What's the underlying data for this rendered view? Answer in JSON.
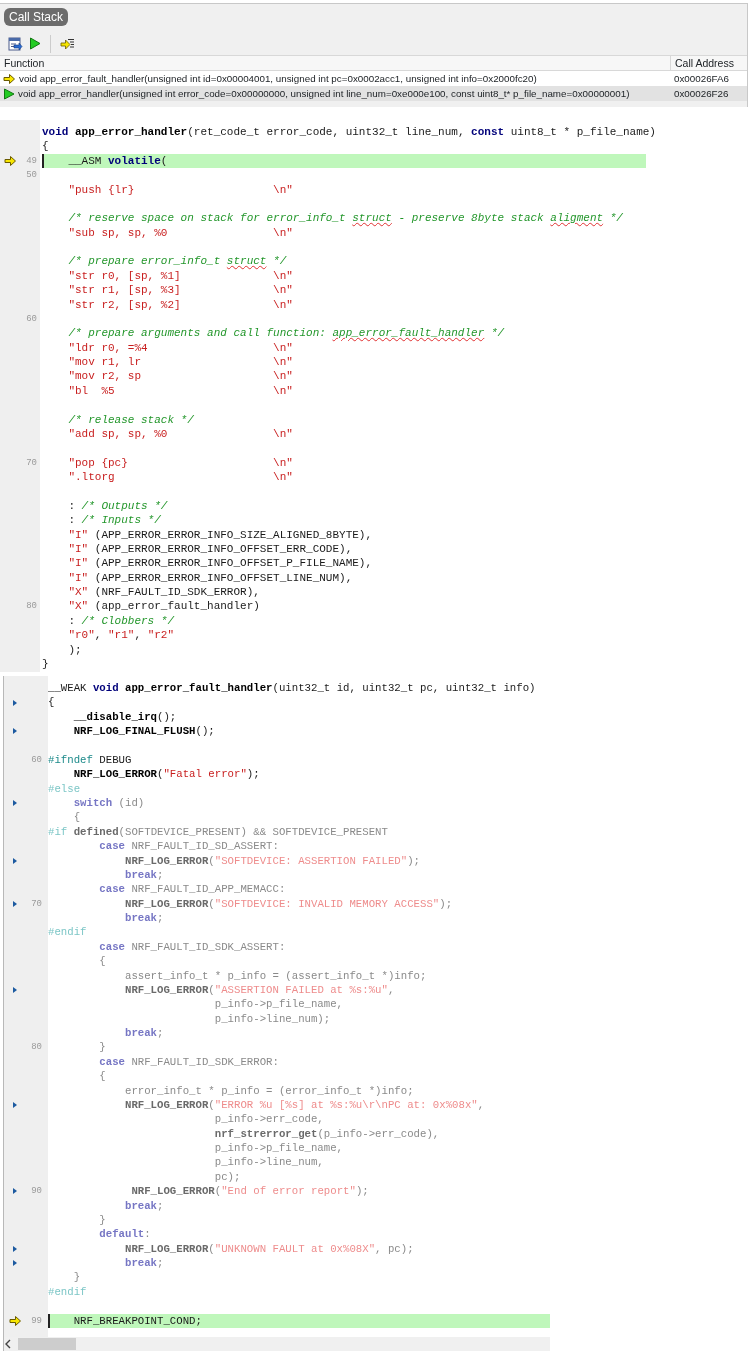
{
  "call_stack": {
    "tab": {
      "label": "Call Stack",
      "selected": true
    },
    "columns": [
      "Function",
      "Call Address"
    ],
    "rows": [
      {
        "kind": "caller",
        "selected": false,
        "function": "void app_error_fault_handler(unsigned int id=0x00004001, unsigned int pc=0x0002acc1, unsigned int info=0x2000fc20)",
        "address": "0x00026FA6"
      },
      {
        "kind": "current",
        "selected": true,
        "function": "void app_error_handler(unsigned int error_code=0x00000000, unsigned int line_num=0xe000e100, const uint8_t* p_file_name=0x00000001)",
        "address": "0x00026F26"
      }
    ]
  },
  "editors": [
    {
      "lines": [
        {
          "kind": "code",
          "tokens": [
            {
              "kind": "keyword",
              "text": "void"
            },
            {
              "kind": "func",
              "text": " app_error_handler"
            },
            {
              "kind": "plain",
              "text": "(ret_code_t error_code, uint32_t line_num, "
            },
            {
              "kind": "keyword",
              "text": "const"
            },
            {
              "kind": "plain",
              "text": " uint8_t * p_file_name)"
            }
          ]
        },
        {
          "kind": "code",
          "tokens": [
            {
              "kind": "plain",
              "text": "{"
            }
          ]
        },
        {
          "kind": "current",
          "number": "49",
          "tokens": [
            {
              "kind": "plain",
              "text": "    __ASM "
            },
            {
              "kind": "keyword",
              "text": "volatile"
            },
            {
              "kind": "plain",
              "text": "("
            }
          ]
        },
        {
          "kind": "blank",
          "number": "50"
        },
        {
          "kind": "code",
          "tokens": [
            {
              "kind": "string",
              "text": "    \"push {lr}                     \\n\""
            }
          ]
        },
        {
          "kind": "blank"
        },
        {
          "kind": "code",
          "tokens": [
            {
              "kind": "comment",
              "text": "    /* reserve space on stack for error_info_t "
            },
            {
              "kind": "spell",
              "text": "struct"
            },
            {
              "kind": "comment",
              "text": " - preserve 8byte stack "
            },
            {
              "kind": "spell",
              "text": "aligment"
            },
            {
              "kind": "comment",
              "text": " */"
            }
          ]
        },
        {
          "kind": "code",
          "tokens": [
            {
              "kind": "string",
              "text": "    \"sub sp, sp, %0                \\n\""
            }
          ]
        },
        {
          "kind": "blank"
        },
        {
          "kind": "code",
          "tokens": [
            {
              "kind": "comment",
              "text": "    /* prepare error_info_t "
            },
            {
              "kind": "spell",
              "text": "struct"
            },
            {
              "kind": "comment",
              "text": " */"
            }
          ]
        },
        {
          "kind": "code",
          "tokens": [
            {
              "kind": "string",
              "text": "    \"str r0, [sp, %1]              \\n\""
            }
          ]
        },
        {
          "kind": "code",
          "tokens": [
            {
              "kind": "string",
              "text": "    \"str r1, [sp, %3]              \\n\""
            }
          ]
        },
        {
          "kind": "code",
          "tokens": [
            {
              "kind": "string",
              "text": "    \"str r2, [sp, %2]              \\n\""
            }
          ]
        },
        {
          "kind": "blank",
          "number": "60"
        },
        {
          "kind": "code",
          "tokens": [
            {
              "kind": "comment",
              "text": "    /* prepare arguments and call function: "
            },
            {
              "kind": "spell",
              "text": "app_error_fault_handler"
            },
            {
              "kind": "comment",
              "text": " */"
            }
          ]
        },
        {
          "kind": "code",
          "tokens": [
            {
              "kind": "string",
              "text": "    \"ldr r0, =%4                   \\n\""
            }
          ]
        },
        {
          "kind": "code",
          "tokens": [
            {
              "kind": "string",
              "text": "    \"mov r1, lr                    \\n\""
            }
          ]
        },
        {
          "kind": "code",
          "tokens": [
            {
              "kind": "string",
              "text": "    \"mov r2, sp                    \\n\""
            }
          ]
        },
        {
          "kind": "code",
          "tokens": [
            {
              "kind": "string",
              "text": "    \"bl  %5                        \\n\""
            }
          ]
        },
        {
          "kind": "blank"
        },
        {
          "kind": "code",
          "tokens": [
            {
              "kind": "comment",
              "text": "    /* release stack */"
            }
          ]
        },
        {
          "kind": "code",
          "tokens": [
            {
              "kind": "string",
              "text": "    \"add sp, sp, %0                \\n\""
            }
          ]
        },
        {
          "kind": "blank"
        },
        {
          "kind": "code",
          "number": "70",
          "tokens": [
            {
              "kind": "string",
              "text": "    \"pop {pc}                      \\n\""
            }
          ]
        },
        {
          "kind": "code",
          "tokens": [
            {
              "kind": "string",
              "text": "    \".ltorg                        \\n\""
            }
          ]
        },
        {
          "kind": "blank"
        },
        {
          "kind": "code",
          "tokens": [
            {
              "kind": "plain",
              "text": "    : "
            },
            {
              "kind": "comment",
              "text": "/* Outputs */"
            }
          ]
        },
        {
          "kind": "code",
          "tokens": [
            {
              "kind": "plain",
              "text": "    : "
            },
            {
              "kind": "comment",
              "text": "/* Inputs */"
            }
          ]
        },
        {
          "kind": "code",
          "tokens": [
            {
              "kind": "string",
              "text": "    \"I\""
            },
            {
              "kind": "plain",
              "text": " (APP_ERROR_ERROR_INFO_SIZE_ALIGNED_8BYTE),"
            }
          ]
        },
        {
          "kind": "code",
          "tokens": [
            {
              "kind": "string",
              "text": "    \"I\""
            },
            {
              "kind": "plain",
              "text": " (APP_ERROR_ERROR_INFO_OFFSET_ERR_CODE),"
            }
          ]
        },
        {
          "kind": "code",
          "tokens": [
            {
              "kind": "string",
              "text": "    \"I\""
            },
            {
              "kind": "plain",
              "text": " (APP_ERROR_ERROR_INFO_OFFSET_P_FILE_NAME),"
            }
          ]
        },
        {
          "kind": "code",
          "tokens": [
            {
              "kind": "string",
              "text": "    \"I\""
            },
            {
              "kind": "plain",
              "text": " (APP_ERROR_ERROR_INFO_OFFSET_LINE_NUM),"
            }
          ]
        },
        {
          "kind": "code",
          "tokens": [
            {
              "kind": "string",
              "text": "    \"X\""
            },
            {
              "kind": "plain",
              "text": " (NRF_FAULT_ID_SDK_ERROR),"
            }
          ]
        },
        {
          "kind": "code",
          "number": "80",
          "tokens": [
            {
              "kind": "string",
              "text": "    \"X\""
            },
            {
              "kind": "plain",
              "text": " (app_error_fault_handler)"
            }
          ]
        },
        {
          "kind": "code",
          "tokens": [
            {
              "kind": "plain",
              "text": "    : "
            },
            {
              "kind": "comment",
              "text": "/* Clobbers */"
            }
          ]
        },
        {
          "kind": "code",
          "tokens": [
            {
              "kind": "string",
              "text": "    \"r0\""
            },
            {
              "kind": "plain",
              "text": ", "
            },
            {
              "kind": "string",
              "text": "\"r1\""
            },
            {
              "kind": "plain",
              "text": ", "
            },
            {
              "kind": "string",
              "text": "\"r2\""
            }
          ]
        },
        {
          "kind": "code",
          "tokens": [
            {
              "kind": "plain",
              "text": "    );"
            }
          ]
        },
        {
          "kind": "code",
          "tokens": [
            {
              "kind": "plain",
              "text": "}"
            }
          ]
        }
      ]
    },
    {
      "lines": [
        {
          "kind": "code",
          "inactive": false,
          "tokens": [
            {
              "kind": "plain",
              "text": "__WEAK "
            },
            {
              "kind": "keyword",
              "text": "void"
            },
            {
              "kind": "func",
              "text": " app_error_fault_handler"
            },
            {
              "kind": "plain",
              "text": "(uint32_t id, uint32_t pc, uint32_t info)"
            }
          ]
        },
        {
          "kind": "slot",
          "inactive": false,
          "tokens": [
            {
              "kind": "plain",
              "text": "{"
            }
          ]
        },
        {
          "kind": "code",
          "inactive": false,
          "tokens": [
            {
              "kind": "func",
              "text": "    __disable_irq"
            },
            {
              "kind": "plain",
              "text": "();"
            }
          ]
        },
        {
          "kind": "slot",
          "inactive": false,
          "tokens": [
            {
              "kind": "func",
              "text": "    NRF_LOG_FINAL_FLUSH"
            },
            {
              "kind": "plain",
              "text": "();"
            }
          ]
        },
        {
          "kind": "blank"
        },
        {
          "kind": "code",
          "inactive": false,
          "number": "60",
          "tokens": [
            {
              "kind": "preproc",
              "text": "#ifndef"
            },
            {
              "kind": "plain",
              "text": " DEBUG"
            }
          ]
        },
        {
          "kind": "code",
          "inactive": false,
          "tokens": [
            {
              "kind": "func",
              "text": "    NRF_LOG_ERROR"
            },
            {
              "kind": "plain",
              "text": "("
            },
            {
              "kind": "string",
              "text": "\"Fatal error\""
            },
            {
              "kind": "plain",
              "text": ");"
            }
          ]
        },
        {
          "kind": "code",
          "inactive": true,
          "tokens": [
            {
              "kind": "preproc",
              "text": "#else"
            }
          ]
        },
        {
          "kind": "slot",
          "inactive": true,
          "tokens": [
            {
              "kind": "keyword",
              "text": "    switch"
            },
            {
              "kind": "plain",
              "text": " (id)"
            }
          ]
        },
        {
          "kind": "code",
          "inactive": true,
          "tokens": [
            {
              "kind": "plain",
              "text": "    {"
            }
          ]
        },
        {
          "kind": "code",
          "inactive": true,
          "tokens": [
            {
              "kind": "preproc",
              "text": "#if"
            },
            {
              "kind": "func",
              "text": " defined"
            },
            {
              "kind": "plain",
              "text": "(SOFTDEVICE_PRESENT) && SOFTDEVICE_PRESENT"
            }
          ]
        },
        {
          "kind": "code",
          "inactive": true,
          "tokens": [
            {
              "kind": "keyword",
              "text": "        case"
            },
            {
              "kind": "plain",
              "text": " NRF_FAULT_ID_SD_ASSERT:"
            }
          ]
        },
        {
          "kind": "slot",
          "inactive": true,
          "tokens": [
            {
              "kind": "func",
              "text": "            NRF_LOG_ERROR"
            },
            {
              "kind": "plain",
              "text": "("
            },
            {
              "kind": "string",
              "text": "\"SOFTDEVICE: ASSERTION FAILED\""
            },
            {
              "kind": "plain",
              "text": ");"
            }
          ]
        },
        {
          "kind": "code",
          "inactive": true,
          "tokens": [
            {
              "kind": "keyword",
              "text": "            break"
            },
            {
              "kind": "plain",
              "text": ";"
            }
          ]
        },
        {
          "kind": "code",
          "inactive": true,
          "tokens": [
            {
              "kind": "keyword",
              "text": "        case"
            },
            {
              "kind": "plain",
              "text": " NRF_FAULT_ID_APP_MEMACC:"
            }
          ]
        },
        {
          "kind": "slot",
          "inactive": true,
          "number": "70",
          "tokens": [
            {
              "kind": "func",
              "text": "            NRF_LOG_ERROR"
            },
            {
              "kind": "plain",
              "text": "("
            },
            {
              "kind": "string",
              "text": "\"SOFTDEVICE: INVALID MEMORY ACCESS\""
            },
            {
              "kind": "plain",
              "text": ");"
            }
          ]
        },
        {
          "kind": "code",
          "inactive": true,
          "tokens": [
            {
              "kind": "keyword",
              "text": "            break"
            },
            {
              "kind": "plain",
              "text": ";"
            }
          ]
        },
        {
          "kind": "code",
          "inactive": true,
          "tokens": [
            {
              "kind": "preproc",
              "text": "#endif"
            }
          ]
        },
        {
          "kind": "code",
          "inactive": true,
          "tokens": [
            {
              "kind": "keyword",
              "text": "        case"
            },
            {
              "kind": "plain",
              "text": " NRF_FAULT_ID_SDK_ASSERT:"
            }
          ]
        },
        {
          "kind": "code",
          "inactive": true,
          "tokens": [
            {
              "kind": "plain",
              "text": "        {"
            }
          ]
        },
        {
          "kind": "code",
          "inactive": true,
          "tokens": [
            {
              "kind": "plain",
              "text": "            assert_info_t * p_info = (assert_info_t *)info;"
            }
          ]
        },
        {
          "kind": "slot",
          "inactive": true,
          "tokens": [
            {
              "kind": "func",
              "text": "            NRF_LOG_ERROR"
            },
            {
              "kind": "plain",
              "text": "("
            },
            {
              "kind": "string",
              "text": "\"ASSERTION FAILED at %s:%u\""
            },
            {
              "kind": "plain",
              "text": ","
            }
          ]
        },
        {
          "kind": "code",
          "inactive": true,
          "tokens": [
            {
              "kind": "plain",
              "text": "                          p_info->p_file_name,"
            }
          ]
        },
        {
          "kind": "code",
          "inactive": true,
          "tokens": [
            {
              "kind": "plain",
              "text": "                          p_info->line_num);"
            }
          ]
        },
        {
          "kind": "code",
          "inactive": true,
          "tokens": [
            {
              "kind": "keyword",
              "text": "            break"
            },
            {
              "kind": "plain",
              "text": ";"
            }
          ]
        },
        {
          "kind": "code",
          "inactive": true,
          "number": "80",
          "tokens": [
            {
              "kind": "plain",
              "text": "        }"
            }
          ]
        },
        {
          "kind": "code",
          "inactive": true,
          "tokens": [
            {
              "kind": "keyword",
              "text": "        case"
            },
            {
              "kind": "plain",
              "text": " NRF_FAULT_ID_SDK_ERROR:"
            }
          ]
        },
        {
          "kind": "code",
          "inactive": true,
          "tokens": [
            {
              "kind": "plain",
              "text": "        {"
            }
          ]
        },
        {
          "kind": "code",
          "inactive": true,
          "tokens": [
            {
              "kind": "plain",
              "text": "            error_info_t * p_info = (error_info_t *)info;"
            }
          ]
        },
        {
          "kind": "slot",
          "inactive": true,
          "tokens": [
            {
              "kind": "func",
              "text": "            NRF_LOG_ERROR"
            },
            {
              "kind": "plain",
              "text": "("
            },
            {
              "kind": "string",
              "text": "\"ERROR %u [%s] at %s:%u\\r\\nPC at: 0x%08x\""
            },
            {
              "kind": "plain",
              "text": ","
            }
          ]
        },
        {
          "kind": "code",
          "inactive": true,
          "tokens": [
            {
              "kind": "plain",
              "text": "                          p_info->err_code,"
            }
          ]
        },
        {
          "kind": "code",
          "inactive": true,
          "tokens": [
            {
              "kind": "func",
              "text": "                          nrf_strerror_get"
            },
            {
              "kind": "plain",
              "text": "(p_info->err_code),"
            }
          ]
        },
        {
          "kind": "code",
          "inactive": true,
          "tokens": [
            {
              "kind": "plain",
              "text": "                          p_info->p_file_name,"
            }
          ]
        },
        {
          "kind": "code",
          "inactive": true,
          "tokens": [
            {
              "kind": "plain",
              "text": "                          p_info->line_num,"
            }
          ]
        },
        {
          "kind": "code",
          "inactive": true,
          "tokens": [
            {
              "kind": "plain",
              "text": "                          pc);"
            }
          ]
        },
        {
          "kind": "slot",
          "inactive": true,
          "number": "90",
          "tokens": [
            {
              "kind": "func",
              "text": "             NRF_LOG_ERROR"
            },
            {
              "kind": "plain",
              "text": "("
            },
            {
              "kind": "string",
              "text": "\"End of error report\""
            },
            {
              "kind": "plain",
              "text": ");"
            }
          ]
        },
        {
          "kind": "code",
          "inactive": true,
          "tokens": [
            {
              "kind": "keyword",
              "text": "            break"
            },
            {
              "kind": "plain",
              "text": ";"
            }
          ]
        },
        {
          "kind": "code",
          "inactive": true,
          "tokens": [
            {
              "kind": "plain",
              "text": "        }"
            }
          ]
        },
        {
          "kind": "code",
          "inactive": true,
          "tokens": [
            {
              "kind": "keyword",
              "text": "        default"
            },
            {
              "kind": "plain",
              "text": ":"
            }
          ]
        },
        {
          "kind": "slot",
          "inactive": true,
          "tokens": [
            {
              "kind": "func",
              "text": "            NRF_LOG_ERROR"
            },
            {
              "kind": "plain",
              "text": "("
            },
            {
              "kind": "string",
              "text": "\"UNKNOWN FAULT at 0x%08X\""
            },
            {
              "kind": "plain",
              "text": ", pc);"
            }
          ]
        },
        {
          "kind": "slot",
          "inactive": true,
          "tokens": [
            {
              "kind": "keyword",
              "text": "            break"
            },
            {
              "kind": "plain",
              "text": ";"
            }
          ]
        },
        {
          "kind": "code",
          "inactive": true,
          "tokens": [
            {
              "kind": "plain",
              "text": "    }"
            }
          ]
        },
        {
          "kind": "code",
          "inactive": true,
          "tokens": [
            {
              "kind": "preproc",
              "text": "#endif"
            }
          ]
        },
        {
          "kind": "blank"
        },
        {
          "kind": "current",
          "inactive": false,
          "number": "99",
          "tokens": [
            {
              "kind": "plain",
              "text": "    NRF_BREAKPOINT_COND;"
            }
          ]
        }
      ]
    }
  ]
}
